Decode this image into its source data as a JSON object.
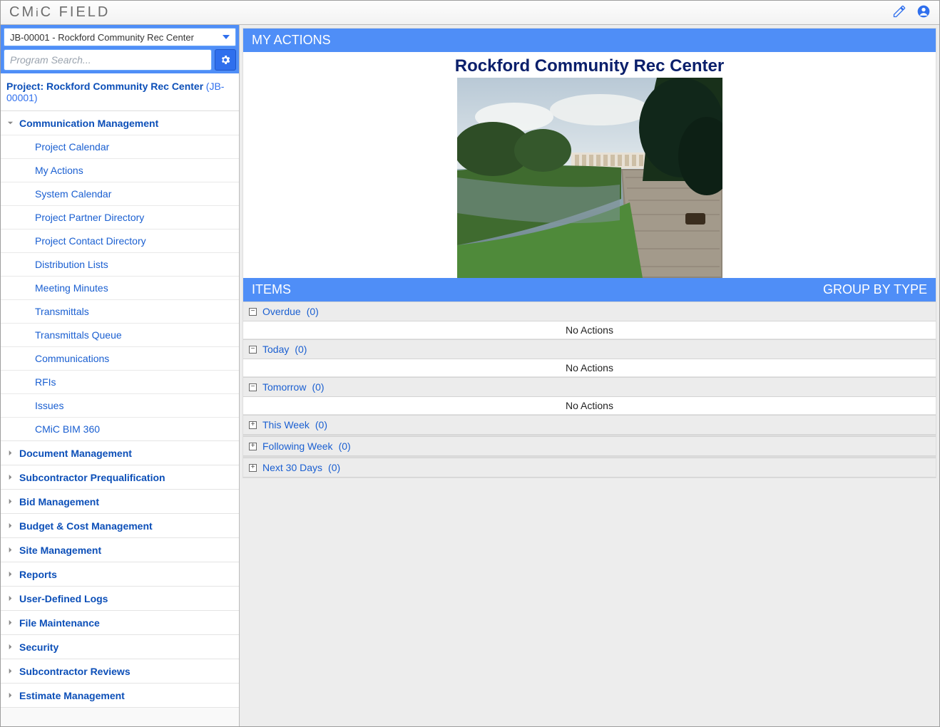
{
  "header": {
    "brand": "CMiC FIELD"
  },
  "sidebar": {
    "project_select_label": "JB-00001 - Rockford Community Rec Center",
    "search_placeholder": "Program Search...",
    "project_label_prefix": "Project: ",
    "project_name": "Rockford Community Rec Center",
    "project_code": "(JB-00001)",
    "nodes": [
      {
        "label": "Communication Management",
        "expanded": true,
        "items": [
          "Project Calendar",
          "My Actions",
          "System Calendar",
          "Project Partner Directory",
          "Project Contact Directory",
          "Distribution Lists",
          "Meeting Minutes",
          "Transmittals",
          "Transmittals Queue",
          "Communications",
          "RFIs",
          "Issues",
          "CMiC BIM 360"
        ]
      },
      {
        "label": "Document Management",
        "expanded": false
      },
      {
        "label": "Subcontractor Prequalification",
        "expanded": false
      },
      {
        "label": "Bid Management",
        "expanded": false
      },
      {
        "label": "Budget & Cost Management",
        "expanded": false
      },
      {
        "label": "Site Management",
        "expanded": false
      },
      {
        "label": "Reports",
        "expanded": false
      },
      {
        "label": "User-Defined Logs",
        "expanded": false
      },
      {
        "label": "File Maintenance",
        "expanded": false
      },
      {
        "label": "Security",
        "expanded": false
      },
      {
        "label": "Subcontractor Reviews",
        "expanded": false
      },
      {
        "label": "Estimate Management",
        "expanded": false
      }
    ]
  },
  "main": {
    "my_actions_title": "MY ACTIONS",
    "hero_title": "Rockford Community Rec Center",
    "items_title": "ITEMS",
    "group_by_label": "GROUP BY TYPE",
    "no_actions_text": "No Actions",
    "groups": [
      {
        "label": "Overdue",
        "count": "(0)",
        "expanded": true,
        "empty": true
      },
      {
        "label": "Today",
        "count": "(0)",
        "expanded": true,
        "empty": true
      },
      {
        "label": "Tomorrow",
        "count": "(0)",
        "expanded": true,
        "empty": true
      },
      {
        "label": "This Week",
        "count": "(0)",
        "expanded": false,
        "empty": false
      },
      {
        "label": "Following Week",
        "count": "(0)",
        "expanded": false,
        "empty": false
      },
      {
        "label": "Next 30 Days",
        "count": "(0)",
        "expanded": false,
        "empty": false
      }
    ]
  }
}
